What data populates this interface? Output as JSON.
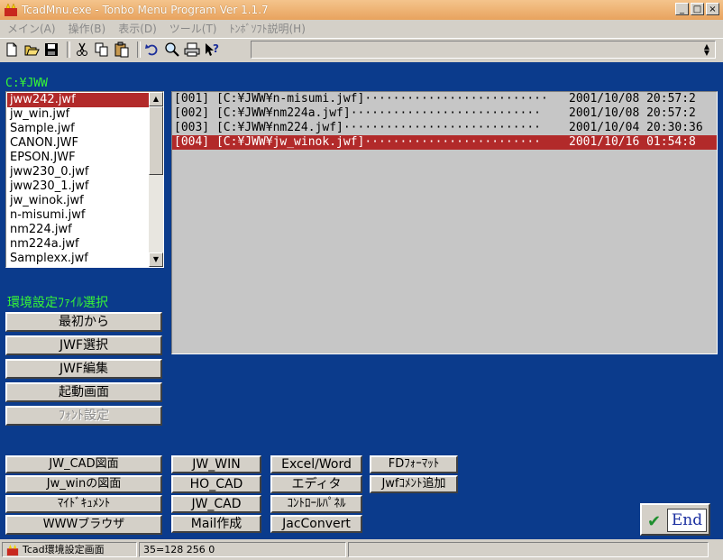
{
  "window": {
    "title": "TcadMnu.exe - Tonbo Menu Program Ver 1.1.7",
    "minimize_glyph": "_",
    "maximize_glyph": "□",
    "close_glyph": "×"
  },
  "menu": [
    "メイン(A)",
    "操作(B)",
    "表示(D)",
    "ツール(T)",
    "ﾄﾝﾎﾞｿﾌﾄ説明(H)"
  ],
  "toolbar": {
    "icons": [
      "new-file-icon",
      "open-folder-icon",
      "save-icon",
      "cut-icon",
      "copy-icon",
      "paste-icon",
      "undo-icon",
      "find-icon",
      "print-icon",
      "context-help-icon"
    ]
  },
  "path_label": "C:¥JWW",
  "files": {
    "items": [
      "jww242.jwf",
      "jw_win.jwf",
      "Sample.jwf",
      "CANON.JWF",
      "EPSON.JWF",
      "jww230_0.jwf",
      "jww230_1.jwf",
      "jw_winok.jwf",
      "n-misumi.jwf",
      "nm224.jwf",
      "nm224a.jwf",
      "Samplexx.jwf"
    ],
    "selected_index": 0,
    "up_arrow": "▲",
    "down_arrow": "▼"
  },
  "history": [
    {
      "id": "[001]",
      "path": "[C:¥JWW¥n-misumi.jwf]",
      "date": "2001/10/08 20:57:2",
      "selected": false
    },
    {
      "id": "[002]",
      "path": "[C:¥JWW¥nm224a.jwf]",
      "date": "2001/10/08 20:57:2",
      "selected": false
    },
    {
      "id": "[003]",
      "path": "[C:¥JWW¥nm224.jwf]",
      "date": "2001/10/04 20:30:36",
      "selected": false
    },
    {
      "id": "[004]",
      "path": "[C:¥JWW¥jw_winok.jwf]",
      "date": "2001/10/16 01:54:8",
      "selected": true
    }
  ],
  "env_label": "環境設定ﾌｧｲﾙ選択",
  "env_buttons": [
    "最初から",
    "JWF選択",
    "JWF編集",
    "起動画面",
    "ﾌｫﾝﾄ設定"
  ],
  "bottom": {
    "col1": [
      "JW_CAD図面",
      "Jw_winの図面",
      "ﾏｲﾄﾞｷｭﾒﾝﾄ",
      "WWWブラウザ"
    ],
    "col2": [
      "JW_WIN",
      "HO_CAD",
      "JW_CAD",
      "Mail作成"
    ],
    "col3": [
      "Excel/Word",
      "エディタ",
      "ｺﾝﾄﾛｰﾙﾊﾟﾈﾙ",
      "JacConvert"
    ],
    "col4": [
      "FDﾌｫｰﾏｯﾄ",
      "Jwfｺﾒﾝﾄ追加"
    ]
  },
  "end_button": {
    "label": "End",
    "check_glyph": "✔"
  },
  "statusbar": {
    "left": "Tcad環境設定画面",
    "mid": "35=128 256 0"
  }
}
